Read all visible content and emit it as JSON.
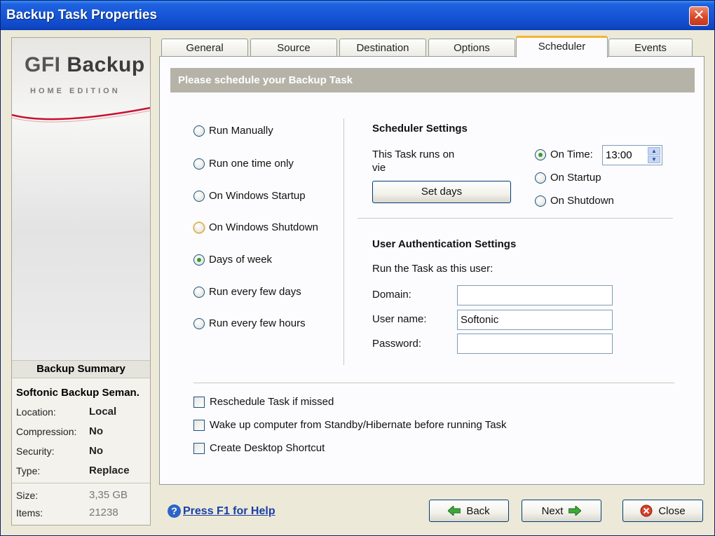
{
  "window": {
    "title": "Backup Task Properties"
  },
  "logo": {
    "brand_a": "GFI",
    "brand_b": " Backup",
    "edition": "HOME EDITION"
  },
  "summary": {
    "heading": "Backup Summary",
    "name": "Softonic Backup Seman.",
    "rows": [
      {
        "label": "Location:",
        "value": "Local"
      },
      {
        "label": "Compression:",
        "value": "No"
      },
      {
        "label": "Security:",
        "value": "No"
      },
      {
        "label": "Type:",
        "value": "Replace"
      }
    ],
    "stats": [
      {
        "label": "Size:",
        "value": "3,35 GB"
      },
      {
        "label": "Items:",
        "value": "21238"
      }
    ]
  },
  "tabs": [
    {
      "label": "General"
    },
    {
      "label": "Source"
    },
    {
      "label": "Destination"
    },
    {
      "label": "Options"
    },
    {
      "label": "Scheduler"
    },
    {
      "label": "Events"
    }
  ],
  "header": "Please schedule your Backup Task",
  "schedule_options": [
    {
      "label": "Run Manually"
    },
    {
      "label": "Run one time only"
    },
    {
      "label": "On Windows Startup"
    },
    {
      "label": "On Windows Shutdown"
    },
    {
      "label": "Days of week"
    },
    {
      "label": "Run every few days"
    },
    {
      "label": "Run every few hours"
    }
  ],
  "scheduler_settings": {
    "title": "Scheduler Settings",
    "runs_on_line1": "This Task runs on",
    "runs_on_line2": "vie",
    "set_days_label": "Set days",
    "time_options": [
      {
        "label": "On Time:"
      },
      {
        "label": "On Startup"
      },
      {
        "label": "On Shutdown"
      }
    ],
    "time_value": "13:00"
  },
  "auth": {
    "title": "User Authentication Settings",
    "subtitle": "Run the Task as this user:",
    "domain_label": "Domain:",
    "domain_value": "",
    "username_label": "User name:",
    "username_value": "Softonic",
    "password_label": "Password:",
    "password_value": ""
  },
  "checkboxes": [
    {
      "label": "Reschedule Task if missed"
    },
    {
      "label": "Wake up computer from Standby/Hibernate before running Task"
    },
    {
      "label": "Create Desktop Shortcut"
    }
  ],
  "footer": {
    "help_label": "Press F1 for Help",
    "back_label": "Back",
    "next_label": "Next",
    "close_label": "Close"
  }
}
